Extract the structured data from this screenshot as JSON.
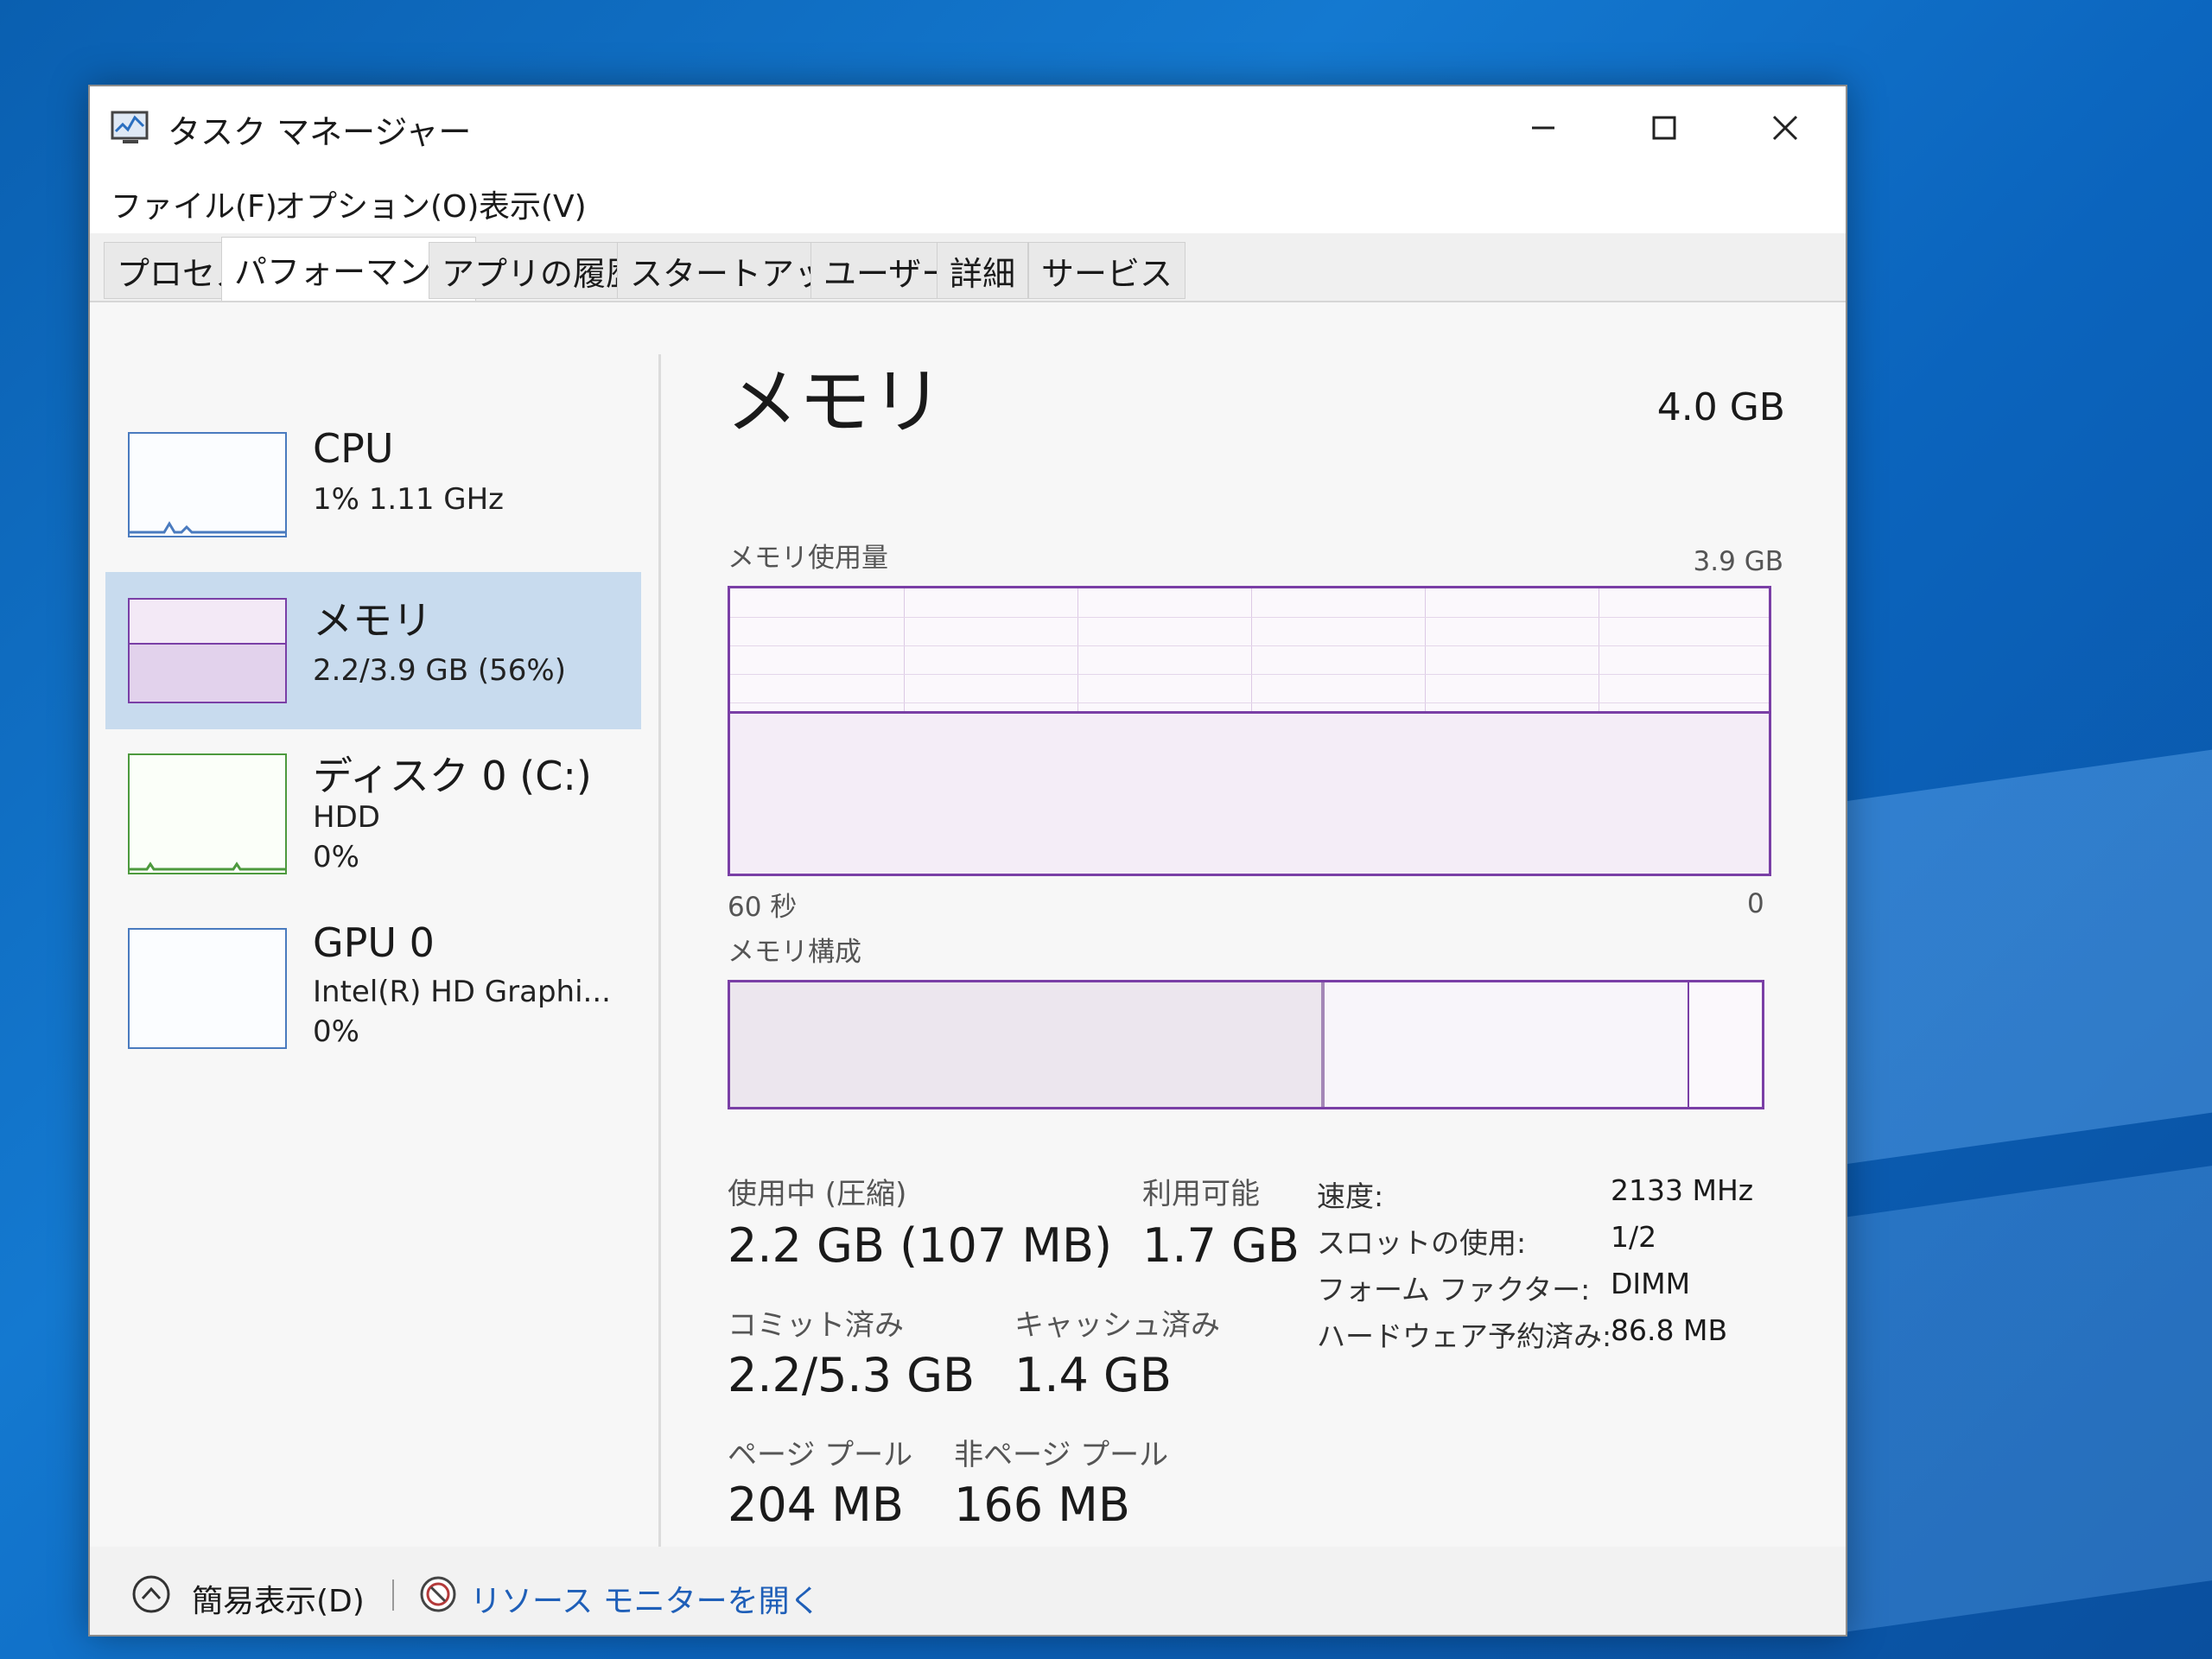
{
  "window": {
    "title": "タスク マネージャー"
  },
  "menu": [
    "ファイル(F)",
    "オプション(O)",
    "表示(V)"
  ],
  "tabs": [
    {
      "label": "プロセス",
      "active": false
    },
    {
      "label": "パフォーマンス",
      "active": true
    },
    {
      "label": "アプリの履歴",
      "active": false
    },
    {
      "label": "スタートアップ",
      "active": false
    },
    {
      "label": "ユーザー",
      "active": false
    },
    {
      "label": "詳細",
      "active": false
    },
    {
      "label": "サービス",
      "active": false
    }
  ],
  "sidebar": {
    "cpu": {
      "title": "CPU",
      "sub1": "1%  1.11 GHz"
    },
    "memory": {
      "title": "メモリ",
      "sub1": "2.2/3.9 GB (56%)",
      "usage_fraction": 0.56
    },
    "disk": {
      "title": "ディスク 0 (C:)",
      "sub1": "HDD",
      "sub2": "0%"
    },
    "gpu": {
      "title": "GPU 0",
      "sub1": "Intel(R) HD Graphi...",
      "sub2": "0%"
    }
  },
  "main": {
    "title": "メモリ",
    "total": "4.0 GB",
    "usage_graph_label": "メモリ使用量",
    "usage_graph_max": "3.9 GB",
    "axis_left": "60 秒",
    "axis_right": "0",
    "composition_label": "メモリ構成",
    "stats": {
      "in_use_label": "使用中 (圧縮)",
      "in_use_value": "2.2 GB (107 MB)",
      "available_label": "利用可能",
      "available_value": "1.7 GB",
      "committed_label": "コミット済み",
      "committed_value": "2.2/5.3 GB",
      "cached_label": "キャッシュ済み",
      "cached_value": "1.4 GB",
      "paged_label": "ページ プール",
      "paged_value": "204 MB",
      "nonpaged_label": "非ページ プール",
      "nonpaged_value": "166 MB"
    },
    "specs": [
      {
        "label": "速度:",
        "value": "2133 MHz"
      },
      {
        "label": "スロットの使用:",
        "value": "1/2"
      },
      {
        "label": "フォーム ファクター:",
        "value": "DIMM"
      },
      {
        "label": "ハードウェア予約済み:",
        "value": "86.8 MB"
      }
    ]
  },
  "footer": {
    "fewer_details": "簡易表示(D)",
    "resource_monitor": "リソース モニターを開く"
  },
  "colors": {
    "memory_accent": "#7a3fa6",
    "link": "#1f5fb8",
    "selected": "#c8dbee"
  }
}
